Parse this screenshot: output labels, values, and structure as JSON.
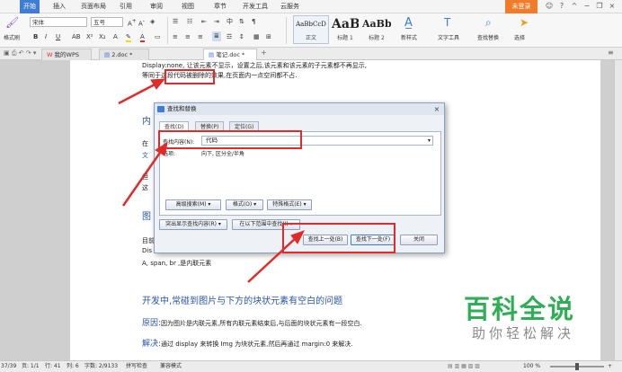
{
  "menubar": {
    "items": [
      "开始",
      "插入",
      "页面布局",
      "引用",
      "审阅",
      "视图",
      "章节",
      "开发工具",
      "云服务"
    ],
    "login": "未登录"
  },
  "ribbon": {
    "format_painter": "格式刷",
    "font_name": "宋体",
    "font_size": "五号",
    "styles": [
      {
        "sample": "AaBbCcD",
        "name": "正文"
      },
      {
        "sample": "AaB",
        "name": "标题 1"
      },
      {
        "sample": "AaBb",
        "name": "标题 2"
      }
    ],
    "new_style": "新样式",
    "text_tools": "文字工具",
    "find_replace": "查找替换",
    "select": "选择"
  },
  "tabs": [
    {
      "label": "我的WPS"
    },
    {
      "label": "2.doc *"
    },
    {
      "label": "笔记.doc *"
    }
  ],
  "document": {
    "line1": "Display:none, 让该元素不显示，设置之后,该元素和该元素的子元素都不再显示,",
    "line2": "等同于这段代码被删除的效果,在页面内一点空间都不占.",
    "frag_heading1": "内",
    "frag_text1": "在",
    "frag_text2": "文",
    "frag_text3": "但",
    "frag_text4": "这",
    "frag_heading2": "图",
    "frag_text5": "目前",
    "frag_text6": "Dis",
    "line_inline": "A, span, br ,是内联元素",
    "heading": "开发中,常碰到图片与下方的块状元素有空白的问题",
    "reason_label": "原因:",
    "reason_text": "因为图片是内联元素,所有内联元素结束后,与后面的块状元素有一段空白.",
    "solution_label": "解决:",
    "solution_text": "通过 display 来转换 Img 为块状元素,然后再通过 margin:0 来解决."
  },
  "dialog": {
    "title": "查找和替换",
    "tabs": [
      "查找(D)",
      "替换(P)",
      "定位(G)"
    ],
    "find_label": "查找内容(N):",
    "find_value": "代码",
    "options_label": "选项:",
    "options_value": "向下, 区分全/半角",
    "advanced": "高级搜索(M) ▾",
    "format": "格式(O) ▾",
    "special": "特殊格式(E) ▾",
    "highlight": "突出显示查找内容(R) ▾",
    "find_in": "在以下范围中查找(I) ▾",
    "find_prev": "查找上一处(B)",
    "find_next": "查找下一处(F)",
    "close": "关闭"
  },
  "watermark": {
    "title": "百科全说",
    "subtitle": "助你轻松解决"
  },
  "statusbar": {
    "page": "页码: 1",
    "pages": "页: 1/1",
    "row": "行: 41",
    "col": "列: 6",
    "words": "字数: 2/9133",
    "spell": "拼写检查",
    "compat": "兼容模式",
    "zoom": "100 %",
    "left_frag": "37/39"
  },
  "colors": {
    "accent": "#3f7cd6",
    "annotation": "#e12b2b",
    "watermark": "#2fae56"
  }
}
